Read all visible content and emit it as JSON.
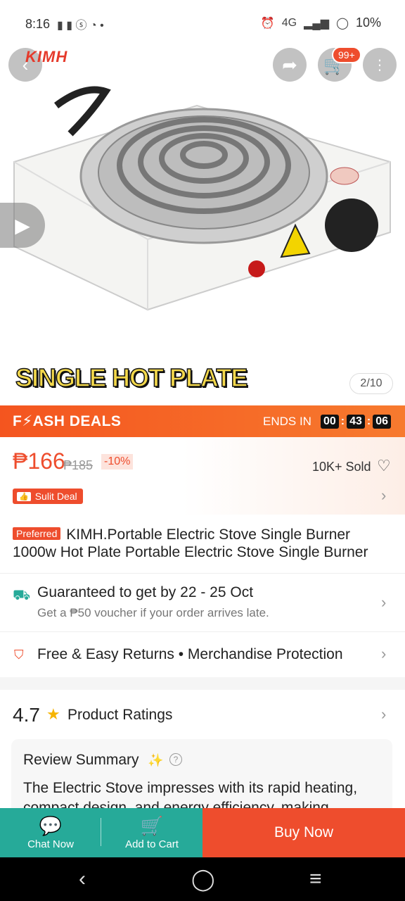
{
  "status_bar": {
    "time": "8:16",
    "network": "4G",
    "battery": "10%"
  },
  "header": {
    "brand_logo": "KIMH",
    "cart_badge": "99+"
  },
  "gallery": {
    "caption": "SINGLE HOT PLATE",
    "counter": "2/10"
  },
  "flash_deal": {
    "title": "F⚡ASH DEALS",
    "ends_in_label": "ENDS IN",
    "timer": [
      "00",
      "43",
      "06"
    ]
  },
  "pricing": {
    "price": "₱166",
    "original_price": "₱185",
    "discount": "-10%",
    "sold": "10K+ Sold",
    "sulit_badge": "Sulit Deal"
  },
  "product": {
    "preferred_badge": "Preferred",
    "title": "KIMH.Portable Electric Stove Single Burner 1000w Hot Plate Portable Electric Stove Single Burner"
  },
  "shipping": {
    "main": "Guaranteed to get by 22 - 25 Oct",
    "sub": "Get a ₱50 voucher if your order arrives late."
  },
  "returns": {
    "text": "Free & Easy Returns  •  Merchandise Protection"
  },
  "ratings": {
    "score": "4.7",
    "label": "Product Ratings"
  },
  "review_summary": {
    "title": "Review Summary",
    "text": "The Electric Stove impresses with its rapid heating, compact design, and energy efficiency, making"
  },
  "bottom_bar": {
    "chat_label": "Chat Now",
    "cart_label": "Add to Cart",
    "buy_label": "Buy Now"
  },
  "colors": {
    "accent": "#ee4d2d",
    "teal": "#26aa99"
  }
}
